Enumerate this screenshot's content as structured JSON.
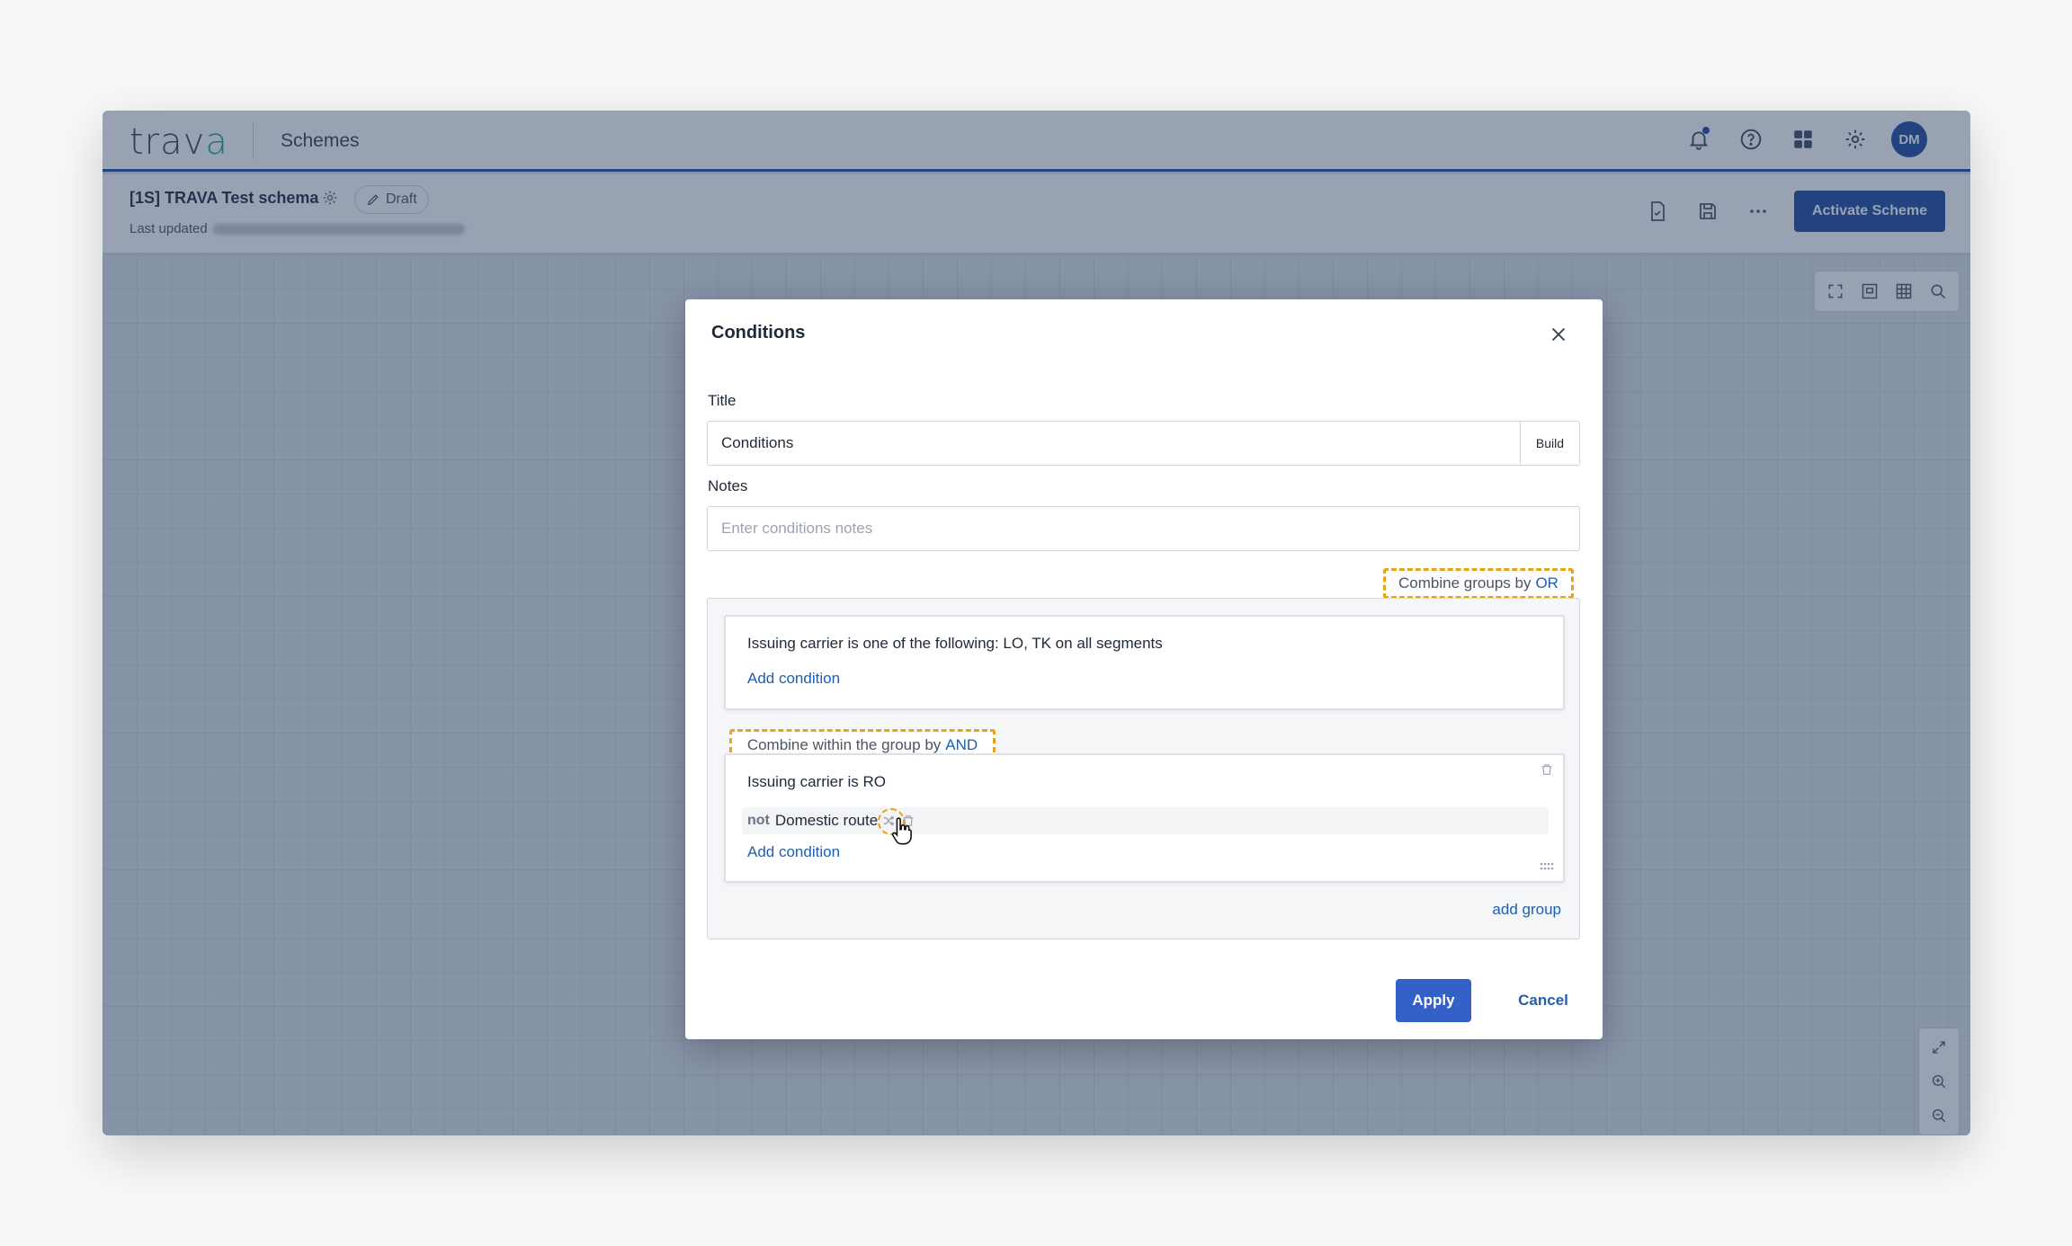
{
  "app": {
    "logo_prefix": "trav",
    "logo_suffix": "a",
    "section": "Schemes"
  },
  "header_icons": [
    "bell-icon",
    "help-icon",
    "apps-grid-icon",
    "gear-icon"
  ],
  "user": {
    "initials": "DM"
  },
  "scheme": {
    "name": "[1S] TRAVA Test schema",
    "status": "Draft",
    "last_updated_label": "Last updated"
  },
  "actions": {
    "activate_label": "Activate Scheme"
  },
  "modal": {
    "title": "Conditions",
    "title_label": "Title",
    "title_value": "Conditions",
    "build_label": "Build",
    "notes_label": "Notes",
    "notes_placeholder": "Enter conditions notes",
    "combine_groups_text": "Combine groups by",
    "combine_groups_op": "OR",
    "groups": [
      {
        "conditions": [
          "Issuing carrier is one of the following: LO, TK on all segments"
        ],
        "add_condition": "Add condition"
      },
      {
        "combine_text": "Combine within the group by",
        "combine_op": "AND",
        "conditions": [
          "Issuing carrier is RO"
        ],
        "negated_condition": {
          "not": "not",
          "name": "Domestic route"
        },
        "add_condition": "Add condition"
      }
    ],
    "add_group": "add group",
    "apply": "Apply",
    "cancel": "Cancel"
  },
  "colors": {
    "brand": "#1e4aa0",
    "highlight": "#e9a21a",
    "link": "#1e5fb0"
  }
}
